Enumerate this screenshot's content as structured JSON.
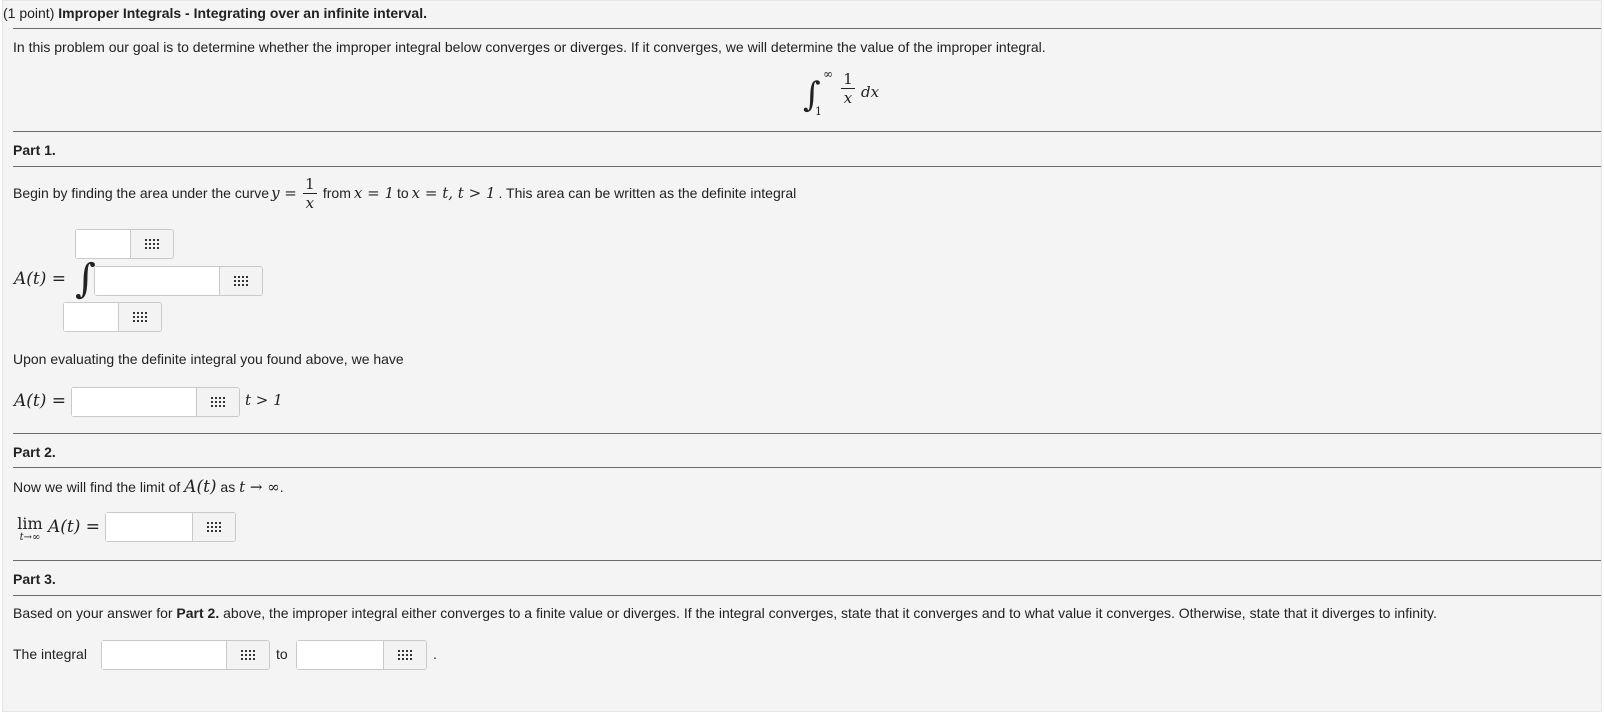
{
  "header": {
    "points": "(1 point)",
    "title": "Improper Integrals - Integrating over an infinite interval."
  },
  "intro": {
    "text": "In this problem our goal is to determine whether the improper integral below converges or diverges. If it converges, we will determine the value of the improper integral.",
    "integral": {
      "upper": "∞",
      "lower": "1",
      "num": "1",
      "den": "x",
      "dx": "dx"
    }
  },
  "part1": {
    "heading": "Part 1.",
    "sentence": {
      "a": "Begin by finding the area under the curve ",
      "y_eq": "y =",
      "num": "1",
      "den": "x",
      "b": " from ",
      "from_expr": "x = 1",
      "c": " to ",
      "to_expr": "x = t, t > 1",
      "d": ". This area can be written as the definite integral"
    },
    "a_label": "A(t) =",
    "integral_sign": "∫",
    "upper_value": "",
    "integrand_value": "",
    "lower_value": "",
    "eval_text": "Upon evaluating the definite integral you found above, we have",
    "a_label2": "A(t) =",
    "result_value": "",
    "condition": "t > 1"
  },
  "part2": {
    "heading": "Part 2.",
    "sentence_a": "Now we will find the limit of ",
    "a_of_t": "A(t)",
    "sentence_b": " as ",
    "t_to_inf": "t → ∞",
    "sentence_c": ".",
    "lim": "lim",
    "lim_sub": "t→∞",
    "lim_expr": "A(t) =",
    "limit_value": ""
  },
  "part3": {
    "heading": "Part 3.",
    "sentence_a": "Based on your answer for ",
    "sentence_bold": "Part 2.",
    "sentence_b": " above, the improper integral either converges to a finite value or diverges. If the integral converges, state that it converges and to what value it converges. Otherwise, state that it diverges to infinity.",
    "the_integral": "The integral",
    "verdict_value": "",
    "to": "to",
    "value_value": "",
    "period": "."
  },
  "icons": {
    "math_editor": "grid-icon"
  }
}
